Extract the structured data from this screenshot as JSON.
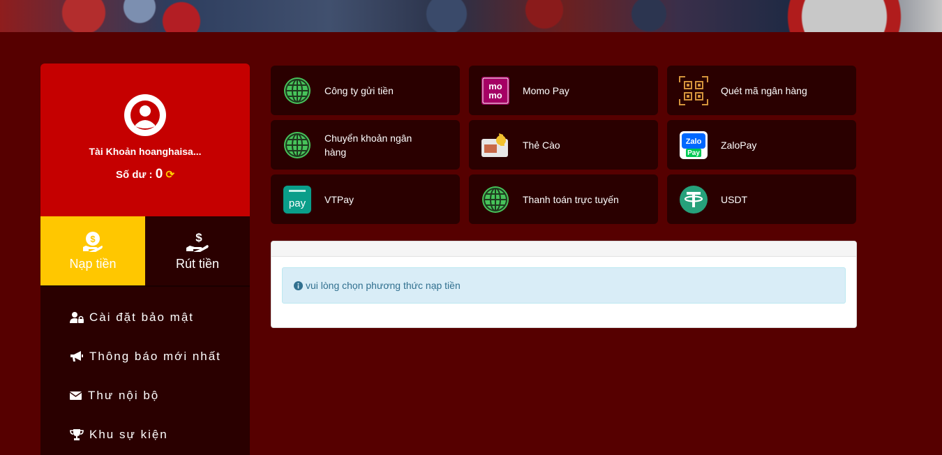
{
  "profile": {
    "account": "Tài Khoản hoanghaisa...",
    "balance_label": "Số dư :",
    "balance_value": "0"
  },
  "actions": [
    {
      "label": "Nạp tiền",
      "icon": "coin-icon",
      "active": true
    },
    {
      "label": "Rút tiền",
      "icon": "withdraw-hand-icon",
      "active": false
    }
  ],
  "menu": [
    {
      "label": "Cài đặt bảo mật",
      "icon": "user-lock-icon"
    },
    {
      "label": "Thông báo mới nhất",
      "icon": "megaphone-icon"
    },
    {
      "label": "Thư nội bộ",
      "icon": "envelope-icon"
    },
    {
      "label": "Khu sự kiện",
      "icon": "trophy-icon"
    }
  ],
  "methods": [
    {
      "label": "Công ty gửi tiền",
      "icon": "globe-icon"
    },
    {
      "label": "Momo Pay",
      "icon": "momo-icon"
    },
    {
      "label": "Quét mã ngân hàng",
      "icon": "qr-code-icon"
    },
    {
      "label": "Chuyển khoản ngân hàng",
      "icon": "globe-icon"
    },
    {
      "label": "Thẻ Cào",
      "icon": "scratch-card-icon"
    },
    {
      "label": "ZaloPay",
      "icon": "zalopay-icon"
    },
    {
      "label": "VTPay",
      "icon": "vtpay-icon"
    },
    {
      "label": "Thanh toán trực tuyến",
      "icon": "globe-icon"
    },
    {
      "label": "USDT",
      "icon": "tether-icon"
    }
  ],
  "alert": {
    "text": "vui lòng chọn phương thức nạp tiền"
  },
  "logos": {
    "momo": "mo mo",
    "zalo": "Zalo Pay",
    "vt": "pay"
  },
  "colors": {
    "background": "#560000",
    "profile": "#c50000",
    "active": "#ffc700",
    "card": "#2a0000"
  }
}
